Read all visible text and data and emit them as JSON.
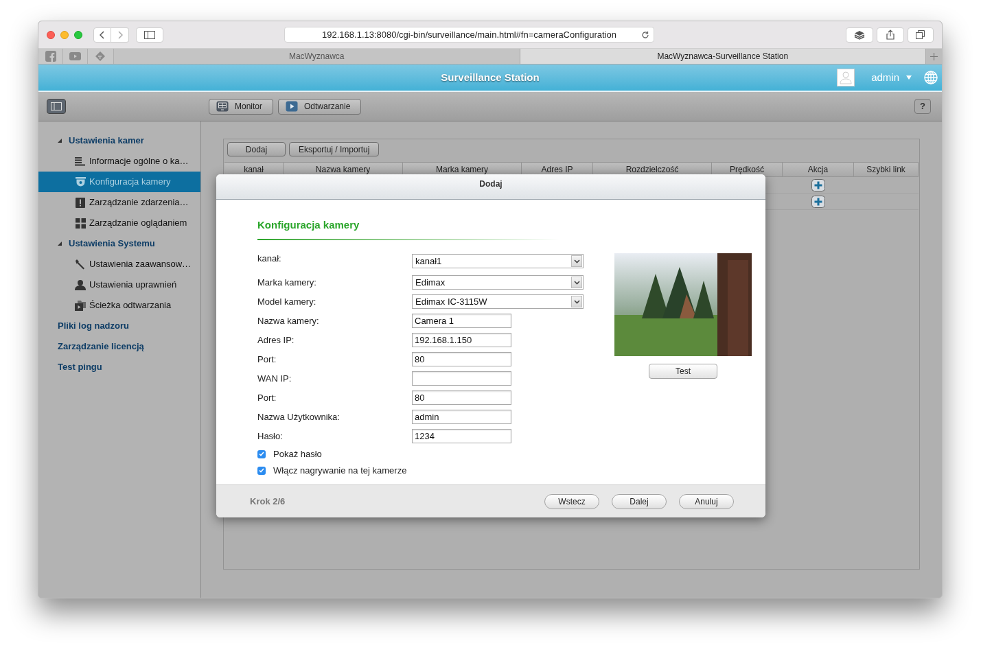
{
  "browser": {
    "url": "192.168.1.13:8080/cgi-bin/surveillance/main.html#fn=cameraConfiguration",
    "tabs": [
      {
        "title": "MacWyznawca",
        "selected": false
      },
      {
        "title": "MacWyznawca-Surveillance Station",
        "selected": true
      }
    ]
  },
  "app": {
    "title": "Surveillance Station",
    "user": "admin"
  },
  "toolbar": {
    "buttons": [
      "Monitor",
      "Odtwarzanie"
    ],
    "help": "?"
  },
  "sidebar": {
    "items": [
      {
        "label": "Ustawienia kamer",
        "kind": "group",
        "expanded": true,
        "selected": false,
        "children": [
          {
            "label": "Informacje ogólne o ka…",
            "selected": false
          },
          {
            "label": "Konfiguracja kamery",
            "selected": true
          },
          {
            "label": "Zarządzanie zdarzenia…",
            "selected": false
          },
          {
            "label": "Zarządzanie oglądaniem",
            "selected": false
          }
        ]
      },
      {
        "label": "Ustawienia Systemu",
        "kind": "group",
        "expanded": true,
        "selected": false,
        "children": [
          {
            "label": "Ustawienia zaawansow…",
            "selected": false
          },
          {
            "label": "Ustawienia uprawnień",
            "selected": false
          },
          {
            "label": "Ścieżka odtwarzania",
            "selected": false
          }
        ]
      },
      {
        "label": "Pliki log nadzoru",
        "kind": "link",
        "selected": false
      },
      {
        "label": "Zarządzanie licencją",
        "kind": "link",
        "selected": false
      },
      {
        "label": "Test pingu",
        "kind": "link",
        "selected": false
      }
    ]
  },
  "content": {
    "buttons": [
      "Dodaj",
      "Eksportuj / Importuj"
    ],
    "table": {
      "columns": [
        "kanał",
        "Nazwa kamery",
        "Marka kamery",
        "Adres IP",
        "Rozdzielczość",
        "Prędkość",
        "Akcja",
        "Szybki link"
      ],
      "rows": [
        {
          "kind": "add"
        },
        {
          "kind": "add"
        }
      ]
    }
  },
  "dialog": {
    "title": "Dodaj",
    "heading": "Konfiguracja kamery",
    "fields": [
      {
        "kind": "select",
        "label": "kanał:",
        "value": "kanał1"
      },
      {
        "kind": "select",
        "label": "Marka kamery:",
        "value": "Edimax"
      },
      {
        "kind": "select",
        "label": "Model kamery:",
        "value": "Edimax IC-3115W"
      },
      {
        "kind": "input",
        "label": "Nazwa kamery:",
        "value": "Camera 1"
      },
      {
        "kind": "input",
        "label": "Adres IP:",
        "value": "192.168.1.150"
      },
      {
        "kind": "input",
        "label": "Port:",
        "value": "80"
      },
      {
        "kind": "input",
        "label": "WAN IP:"
      },
      {
        "kind": "input",
        "label": "Port:",
        "value": "80"
      },
      {
        "kind": "input",
        "label": "Nazwa Użytkownika:",
        "value": "admin"
      },
      {
        "kind": "input",
        "label": "Hasło:",
        "value": "1234"
      }
    ],
    "checkboxes": [
      {
        "label": "Pokaż hasło",
        "checked": true
      },
      {
        "label": "Włącz nagrywanie na tej kamerze",
        "checked": true
      }
    ],
    "test_button": "Test",
    "step": "Krok 2/6",
    "buttons": [
      "Wstecz",
      "Dalej",
      "Anuluj"
    ]
  }
}
